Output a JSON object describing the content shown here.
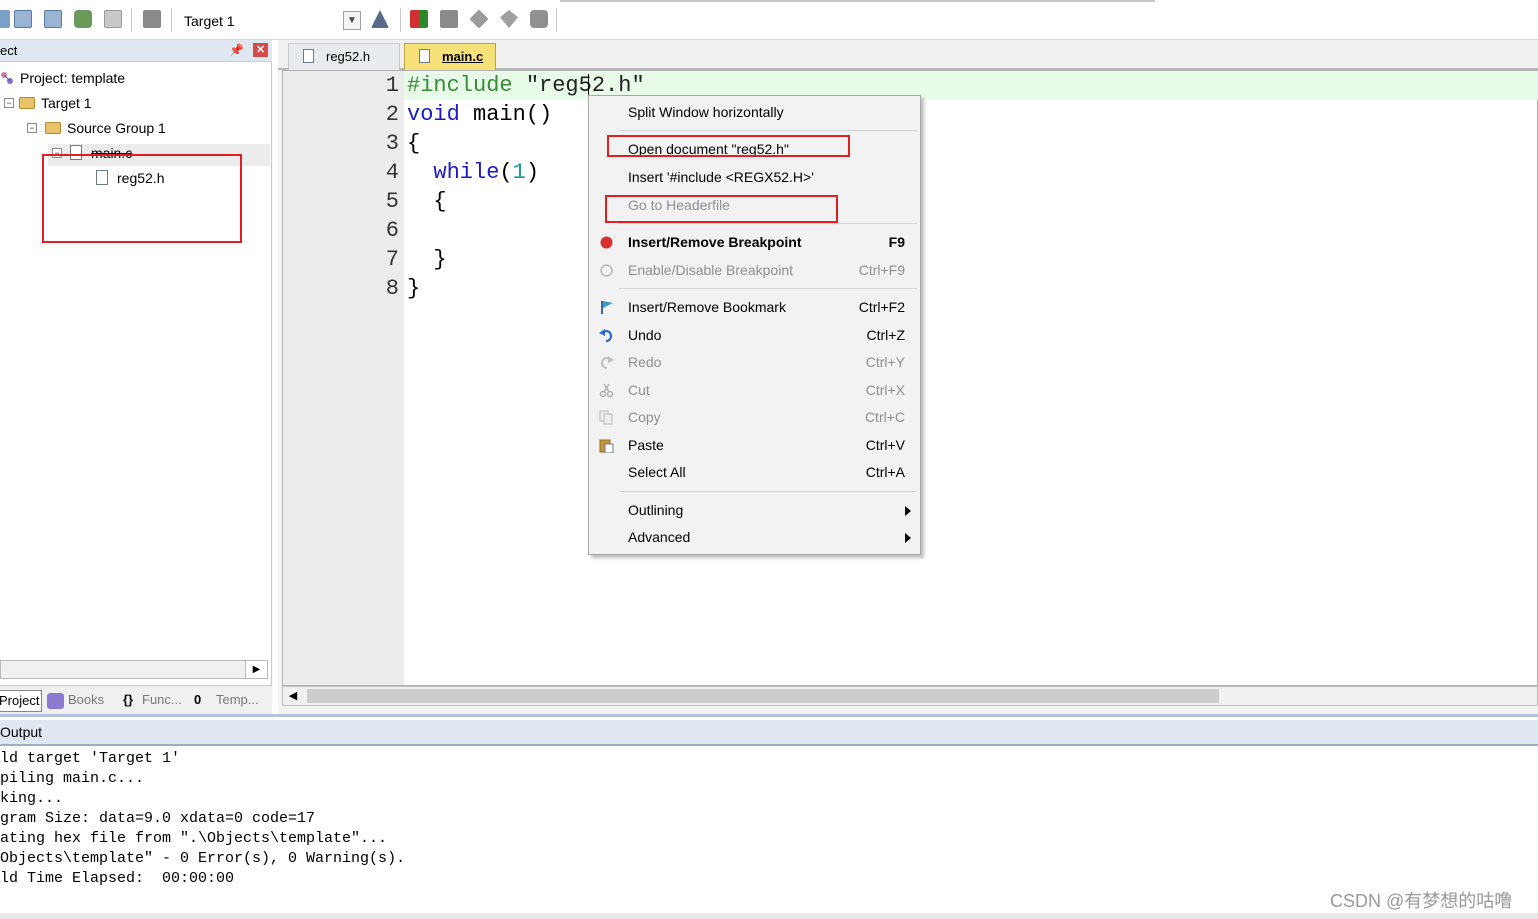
{
  "toolbar": {
    "target_value": "Target 1",
    "icons": [
      "translate-icon",
      "build-icon",
      "rebuild-icon",
      "batch-build-icon",
      "stop-build-icon",
      "load-icon",
      "target-dropdown-icon",
      "target-options-icon",
      "manage-components-icon",
      "select-packs-icon",
      "pack-installer-icon",
      "manage-run-env-icon",
      "books-toolbar-icon"
    ]
  },
  "project_pane": {
    "header_title": "ect",
    "tree": {
      "project_label": "Project: template",
      "target_label": "Target 1",
      "group_label": "Source Group 1",
      "file_main": "main.c",
      "file_reg52": "reg52.h"
    },
    "tabs": {
      "project": "Project",
      "books": "Books",
      "functions": "Func...",
      "templates": "Temp..."
    }
  },
  "editor": {
    "tabs": [
      {
        "label": "reg52.h",
        "active": false
      },
      {
        "label": "main.c",
        "active": true
      }
    ],
    "line_numbers": [
      "1",
      "2",
      "3",
      "4",
      "5",
      "6",
      "7",
      "8"
    ],
    "code": {
      "l1_pp": "#include",
      "l1_str": " \"reg52.h\"",
      "l2_kw": "void",
      "l2_rest": " main()",
      "l3": "{",
      "l4_kw": "  while",
      "l4_open": "(",
      "l4_num": "1",
      "l4_close": ")",
      "l5": "  {",
      "l6": "",
      "l7": "  }",
      "l8": "}"
    }
  },
  "context_menu": {
    "items": [
      {
        "label": "Split Window horizontally",
        "shortcut": "",
        "disabled": false
      },
      {
        "label": "Open document \"reg52.h\"",
        "shortcut": "",
        "disabled": false
      },
      {
        "label": "Insert '#include <REGX52.H>'",
        "shortcut": "",
        "disabled": false
      },
      {
        "label": "Go to Headerfile",
        "shortcut": "",
        "disabled": true
      },
      {
        "label": "Insert/Remove Breakpoint",
        "shortcut": "F9",
        "disabled": false,
        "icon": "breakpoint-icon"
      },
      {
        "label": "Enable/Disable Breakpoint",
        "shortcut": "Ctrl+F9",
        "disabled": true,
        "icon": "breakpoint-toggle-icon"
      },
      {
        "label": "Insert/Remove Bookmark",
        "shortcut": "Ctrl+F2",
        "disabled": false,
        "icon": "bookmark-icon"
      },
      {
        "label": "Undo",
        "shortcut": "Ctrl+Z",
        "disabled": false,
        "icon": "undo-icon"
      },
      {
        "label": "Redo",
        "shortcut": "Ctrl+Y",
        "disabled": true,
        "icon": "redo-icon"
      },
      {
        "label": "Cut",
        "shortcut": "Ctrl+X",
        "disabled": true,
        "icon": "cut-icon"
      },
      {
        "label": "Copy",
        "shortcut": "Ctrl+C",
        "disabled": true,
        "icon": "copy-icon"
      },
      {
        "label": "Paste",
        "shortcut": "Ctrl+V",
        "disabled": false,
        "icon": "paste-icon"
      },
      {
        "label": "Select All",
        "shortcut": "Ctrl+A",
        "disabled": false
      },
      {
        "label": "Outlining",
        "shortcut": "",
        "disabled": false,
        "submenu": true
      },
      {
        "label": "Advanced",
        "shortcut": "",
        "disabled": false,
        "submenu": true
      }
    ]
  },
  "output": {
    "header_title": "Output",
    "lines": [
      "ld target 'Target 1'",
      "piling main.c...",
      "king...",
      "gram Size: data=9.0 xdata=0 code=17",
      "ating hex file from \".\\Objects\\template\"...",
      "Objects\\template\" - 0 Error(s), 0 Warning(s).",
      "ld Time Elapsed:  00:00:00"
    ]
  },
  "watermark": "CSDN @有梦想的咕噜",
  "colors": {
    "annotation_red": "#e02020",
    "active_tab": "#f7e27a",
    "line_highlight": "#e8fbe9",
    "keyword_blue": "#1a1ac8",
    "preprocessor_green": "#3a8a3a"
  }
}
